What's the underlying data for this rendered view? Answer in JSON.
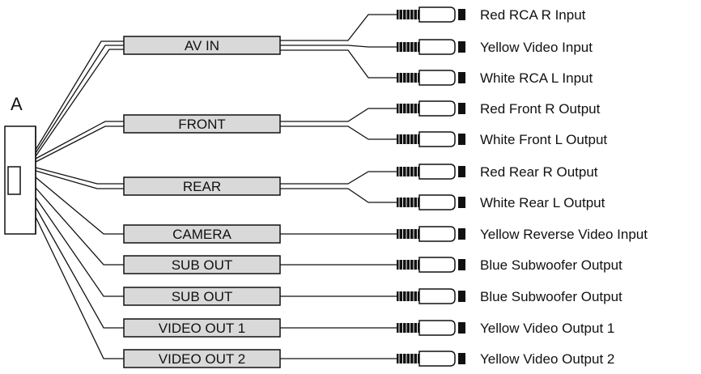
{
  "diagram": {
    "connector_label": "A",
    "colors": {
      "line": "#111111",
      "box_fill": "#d9d9d9",
      "background": "#ffffff"
    },
    "groups": [
      {
        "label": "AV IN",
        "outputs": [
          "Red  RCA R  Input",
          "Yellow  Video  Input",
          "White  RCA  L  Input"
        ]
      },
      {
        "label": "FRONT",
        "outputs": [
          "Red  Front  R  Output",
          "White Front L Output"
        ]
      },
      {
        "label": "REAR",
        "outputs": [
          "Red Rear R Output",
          "White Rear L Output"
        ]
      },
      {
        "label": "CAMERA",
        "outputs": [
          "Yellow Reverse Video Input"
        ]
      },
      {
        "label": "SUB OUT",
        "outputs": [
          "Blue Subwoofer Output"
        ]
      },
      {
        "label": "SUB OUT",
        "outputs": [
          "Blue Subwoofer Output"
        ]
      },
      {
        "label": "VIDEO OUT 1",
        "outputs": [
          "Yellow Video Output 1"
        ]
      },
      {
        "label": "VIDEO OUT 2",
        "outputs": [
          "Yellow Video Output 2"
        ]
      }
    ]
  }
}
